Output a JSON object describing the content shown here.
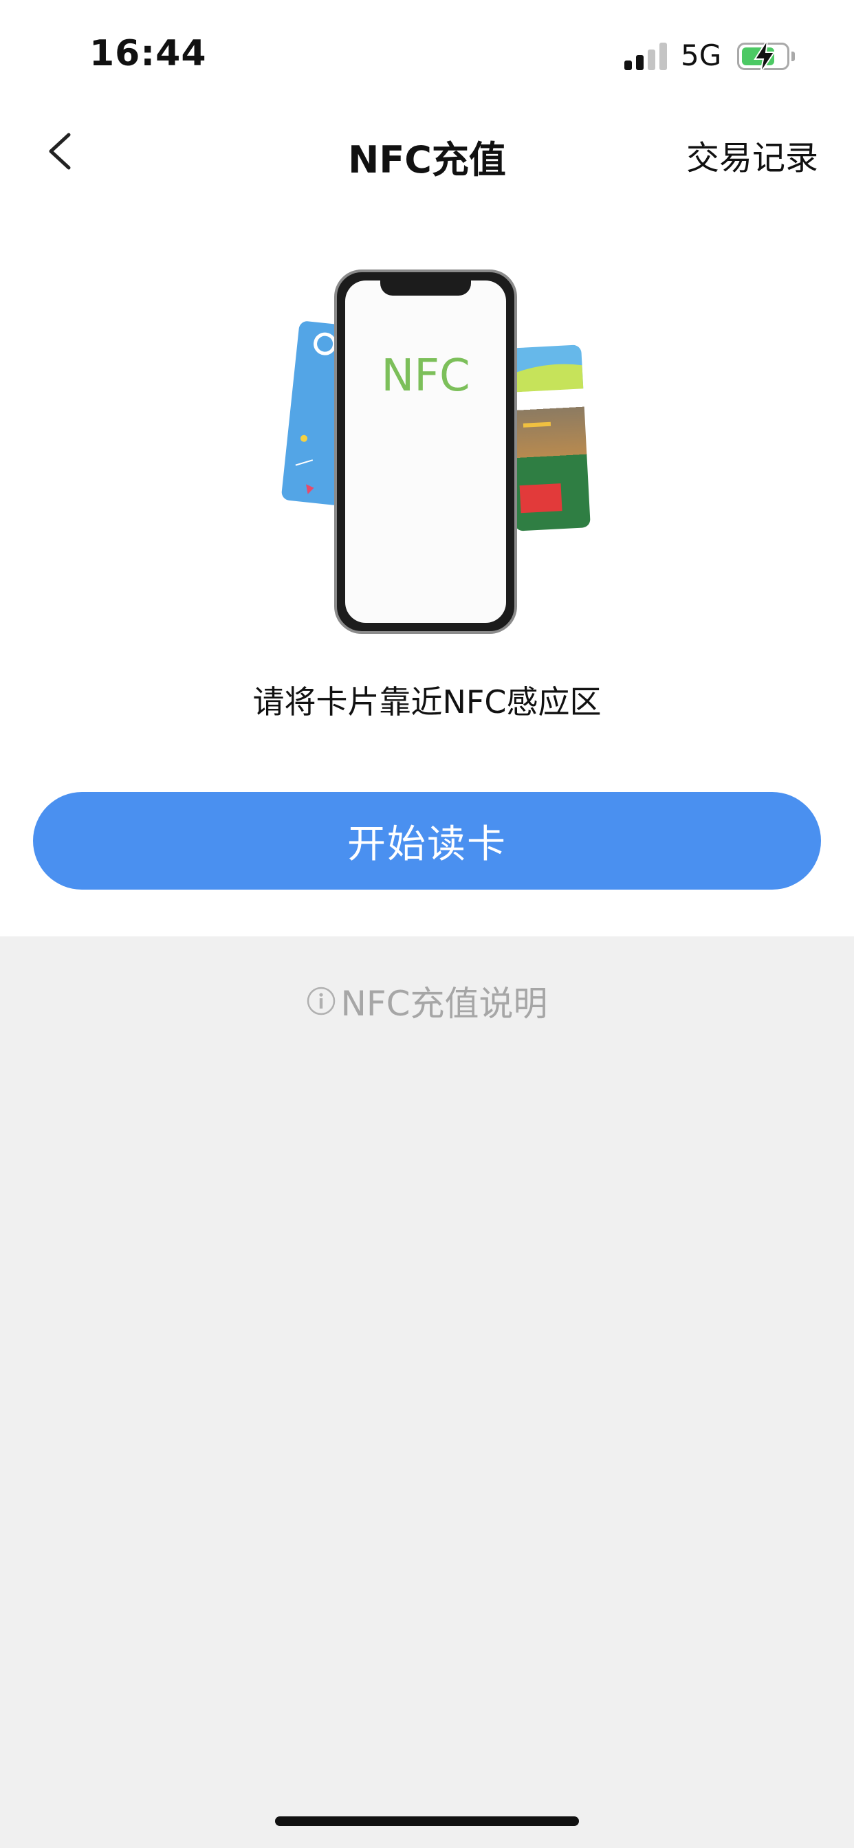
{
  "status_bar": {
    "time": "16:44",
    "network": "5G",
    "signal_bars_active": 2,
    "signal_bars_total": 4,
    "battery_level": 0.75,
    "battery_charging": true,
    "battery_color": "#4cc964"
  },
  "nav": {
    "back_icon": "chevron-left-icon",
    "title": "NFC充值",
    "action_label": "交易记录"
  },
  "illustration": {
    "phone_screen_text": "NFC"
  },
  "main": {
    "hint": "请将卡片靠近NFC感应区",
    "start_button_label": "开始读卡",
    "accent_color": "#4a90f0"
  },
  "footer": {
    "info_icon": "info-circle-icon",
    "info_label": "NFC充值说明"
  }
}
